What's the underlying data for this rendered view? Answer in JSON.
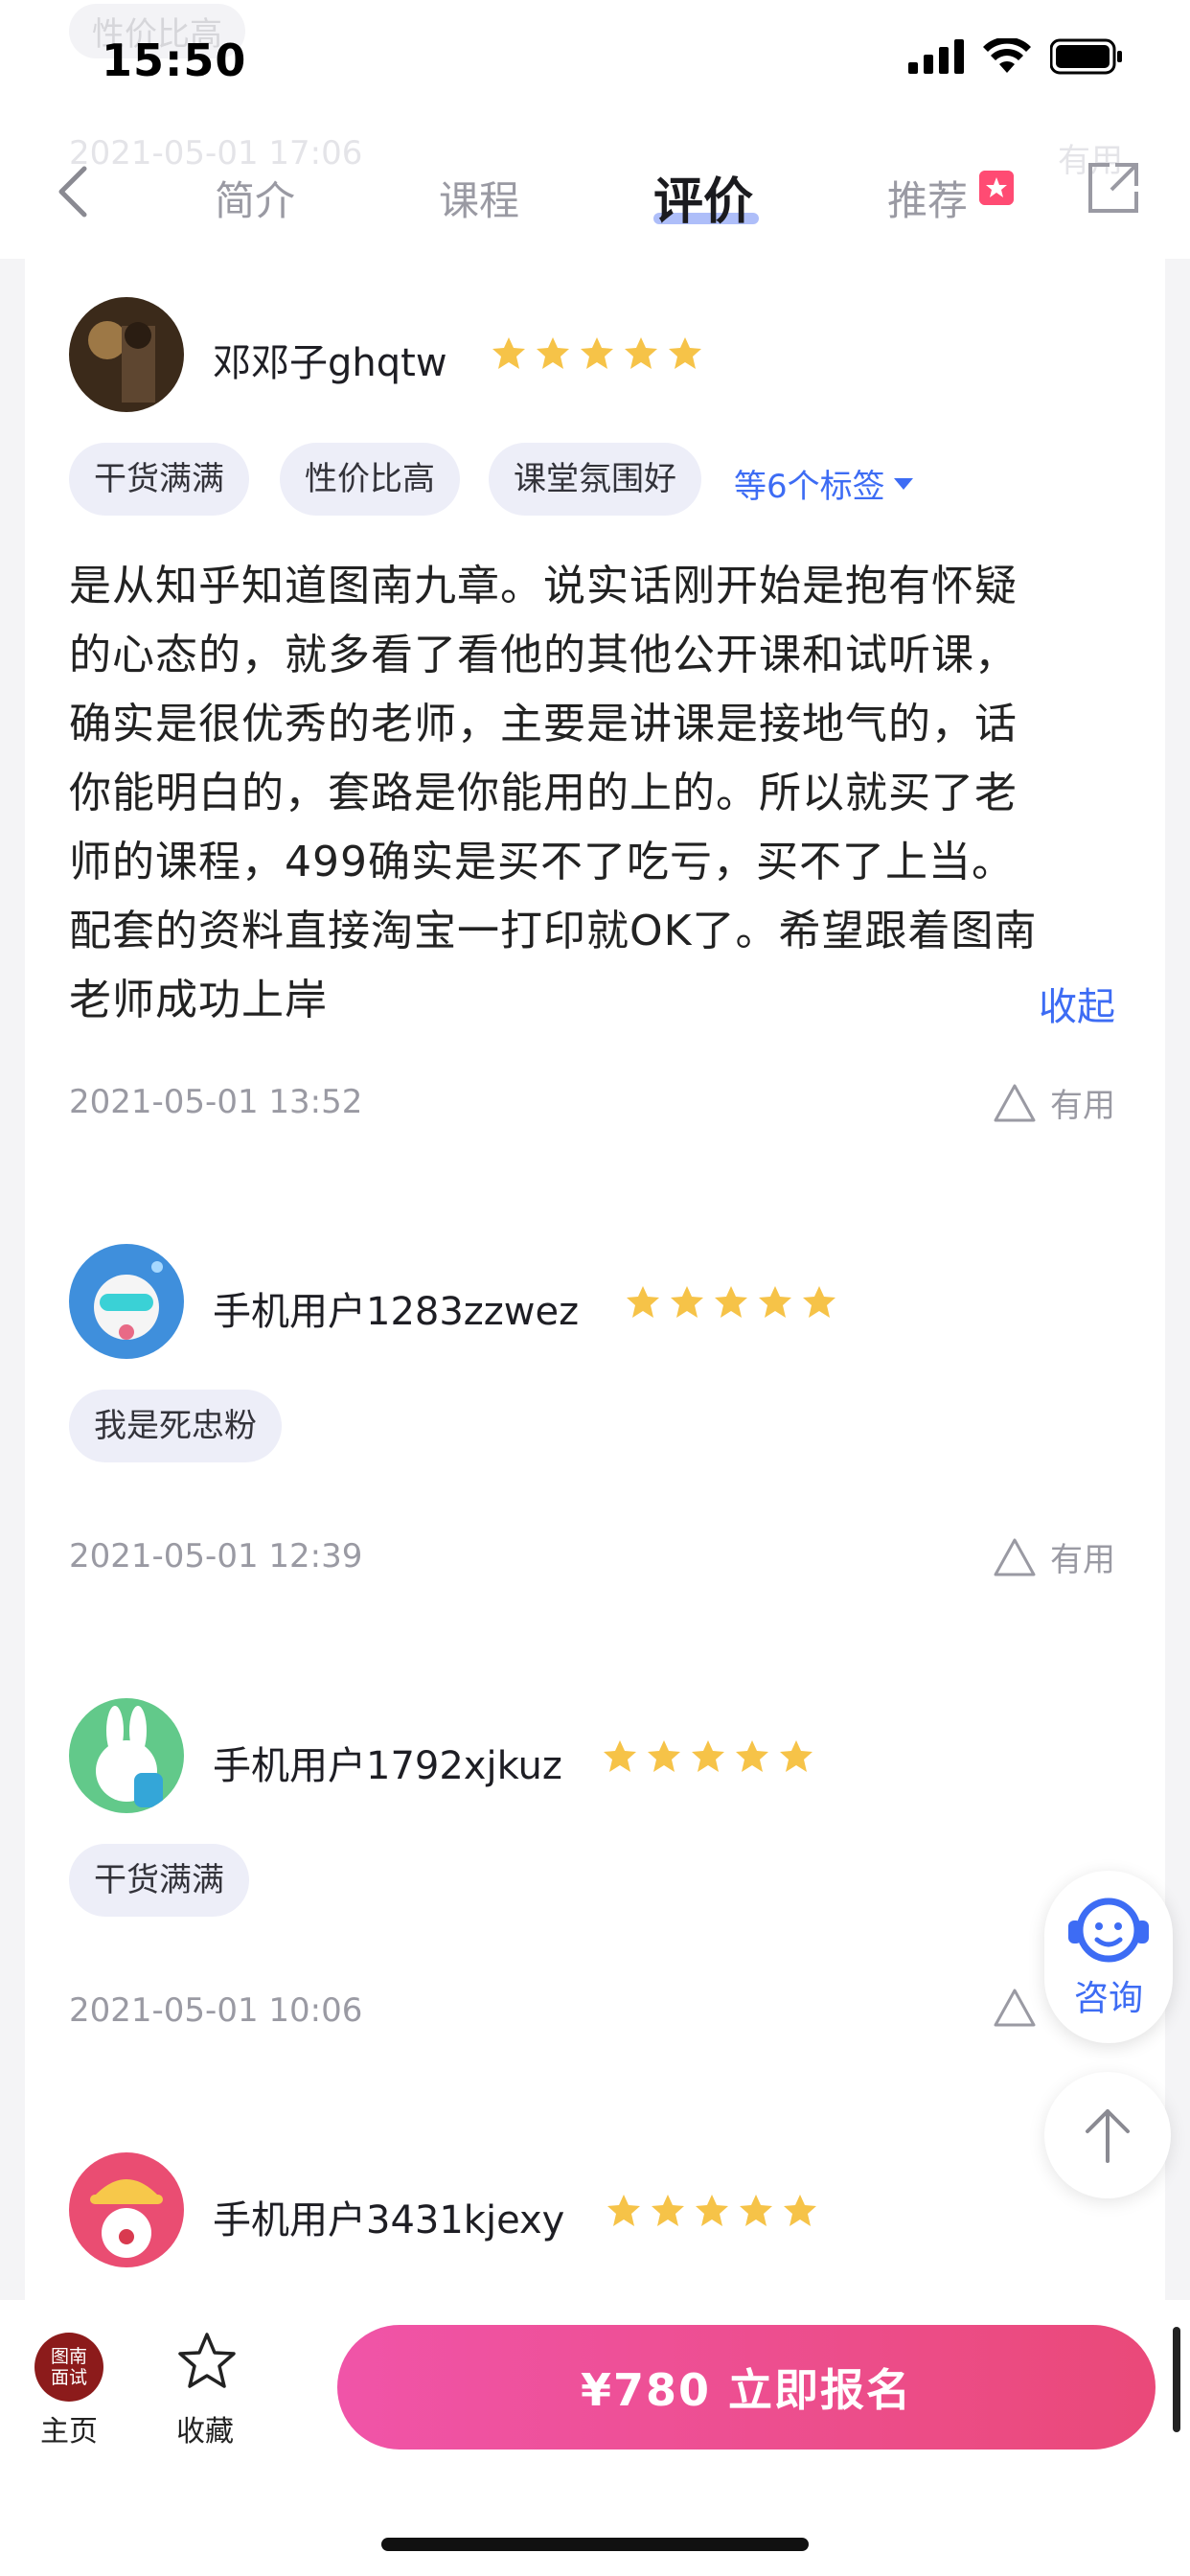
{
  "status_bar": {
    "time": "15:50"
  },
  "ghost": {
    "chip": "性价比高",
    "date": "2021-05-01 17:06",
    "useful": "有用"
  },
  "nav": {
    "tabs": [
      {
        "label": "简介"
      },
      {
        "label": "课程"
      },
      {
        "label": "评价",
        "active": true
      },
      {
        "label": "推荐"
      }
    ]
  },
  "reviews": [
    {
      "user": "邓邓子ghqtw",
      "rating": 5,
      "tags": [
        "干货满满",
        "性价比高",
        "课堂氛围好"
      ],
      "more_tags": "等6个标签",
      "text_lines": [
        "是从知乎知道图南九章。说实话刚开始是抱有怀疑",
        "的心态的，就多看了看他的其他公开课和试听课，",
        "确实是很优秀的老师，主要是讲课是接地气的，话",
        "你能明白的，套路是你能用的上的。所以就买了老",
        "师的课程，499确实是买不了吃亏，买不了上当。",
        "配套的资料直接淘宝一打印就OK了。希望跟着图南",
        "老师成功上岸"
      ],
      "collapse": "收起",
      "date": "2021-05-01 13:52",
      "useful": "有用"
    },
    {
      "user": "手机用户1283zzwez",
      "rating": 5,
      "tags": [
        "我是死忠粉"
      ],
      "date": "2021-05-01 12:39",
      "useful": "有用"
    },
    {
      "user": "手机用户1792xjkuz",
      "rating": 5,
      "tags": [
        "干货满满"
      ],
      "date": "2021-05-01 10:06"
    },
    {
      "user": "手机用户3431kjexy",
      "rating": 5
    }
  ],
  "float": {
    "consult": "咨询"
  },
  "bottom": {
    "logo_line1": "图南",
    "logo_line2": "面试",
    "home": "主页",
    "favorite": "收藏",
    "enroll": "¥780  立即报名"
  },
  "colors": {
    "accent": "#3d6cf4",
    "star": "#f6c348",
    "button_start": "#f054a8",
    "button_end": "#ea4979"
  }
}
